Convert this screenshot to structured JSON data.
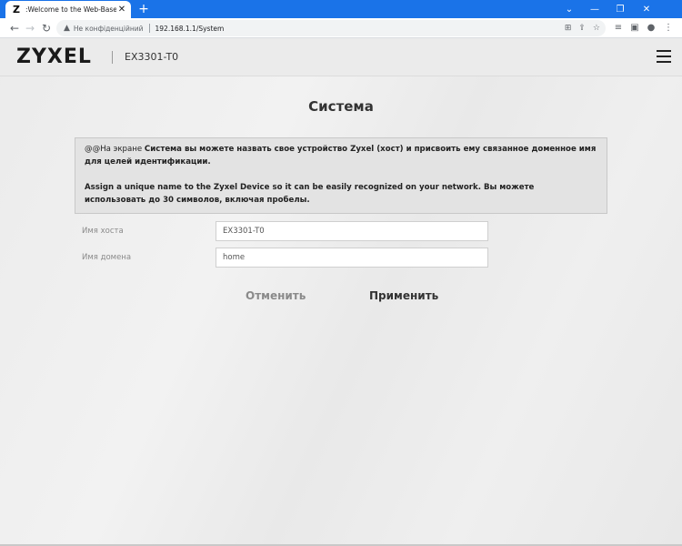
{
  "browser": {
    "tab_title": ":Welcome to the Web-Based Co",
    "tab_favicon": "Z",
    "security_label": "Не конфіденційний",
    "url": "192.168.1.1/System"
  },
  "header": {
    "logo": "ZYXEL",
    "model": "EX3301-T0"
  },
  "page": {
    "title": "Система",
    "info_line1_prefix": "@@На экране ",
    "info_line1_bold": "Система",
    "info_line1_rest": " вы можете назвать свое устройство Zyxel (хост) и присвоить ему связанное доменное имя для целей идентификации.",
    "info_line2": "Assign a unique name to the Zyxel Device so it can be easily recognized on your network. Вы можете использовать до 30 символов, включая пробелы."
  },
  "form": {
    "host_label": "Имя хоста",
    "host_value": "EX3301-T0",
    "domain_label": "Имя домена",
    "domain_value": "home"
  },
  "buttons": {
    "cancel": "Отменить",
    "apply": "Применить"
  },
  "colors": {
    "chrome_blue": "#1a73e8",
    "apply_accent": "#f5a130"
  }
}
